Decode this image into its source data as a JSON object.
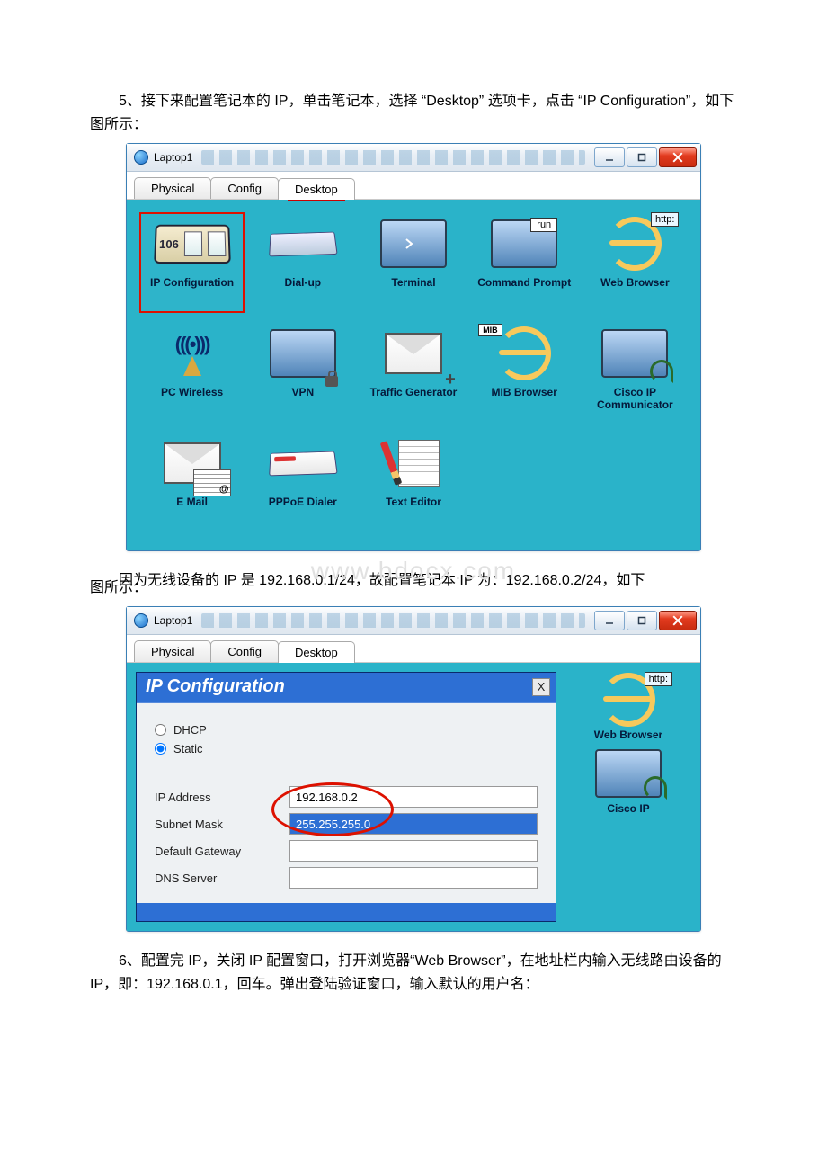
{
  "paragraphs": {
    "p1": "5、接下来配置笔记本的 IP，单击笔记本，选择 “Desktop” 选项卡，点击 “IP Configuration”，如下图所示：",
    "p2_a": "因为无线设备的 IP 是 192.168.0.1/24，故配置笔记本 IP 为：192.168.0.2/24，如下",
    "p2_b": "图所示：",
    "p3": "6、配置完 IP，关闭 IP 配置窗口，打开浏览器“Web Browser”，在地址栏内输入无线路由设备的 IP，即：192.168.0.1，回车。弹出登陆验证窗口，输入默认的用户名："
  },
  "watermark": "www.bdocx.com",
  "window1": {
    "title": "Laptop1",
    "tabs": {
      "physical": "Physical",
      "config": "Config",
      "desktop": "Desktop"
    },
    "tiles": {
      "ipconf_digits": "106",
      "ipconf": "IP Configuration",
      "dialup": "Dial-up",
      "terminal": "Terminal",
      "run": "run",
      "cmd": "Command Prompt",
      "http": "http:",
      "web": "Web Browser",
      "wireless": "PC Wireless",
      "vpn": "VPN",
      "traffic": "Traffic Generator",
      "mib_tag": "MIB",
      "mib": "MIB Browser",
      "cisco": "Cisco IP Communicator",
      "email": "E Mail",
      "pppoe": "PPPoE Dialer",
      "texteditor": "Text Editor"
    }
  },
  "window2": {
    "title": "Laptop1",
    "tabs": {
      "physical": "Physical",
      "config": "Config",
      "desktop": "Desktop"
    },
    "panel": {
      "heading": "IP Configuration",
      "dhcp": "DHCP",
      "static": "Static",
      "ip_label": "IP Address",
      "ip_value": "192.168.0.2",
      "mask_label": "Subnet Mask",
      "mask_value": "255.255.255.0",
      "gw_label": "Default Gateway",
      "gw_value": "",
      "dns_label": "DNS Server",
      "dns_value": ""
    },
    "side": {
      "http": "http:",
      "web": "Web Browser",
      "cisco": "Cisco IP"
    }
  }
}
